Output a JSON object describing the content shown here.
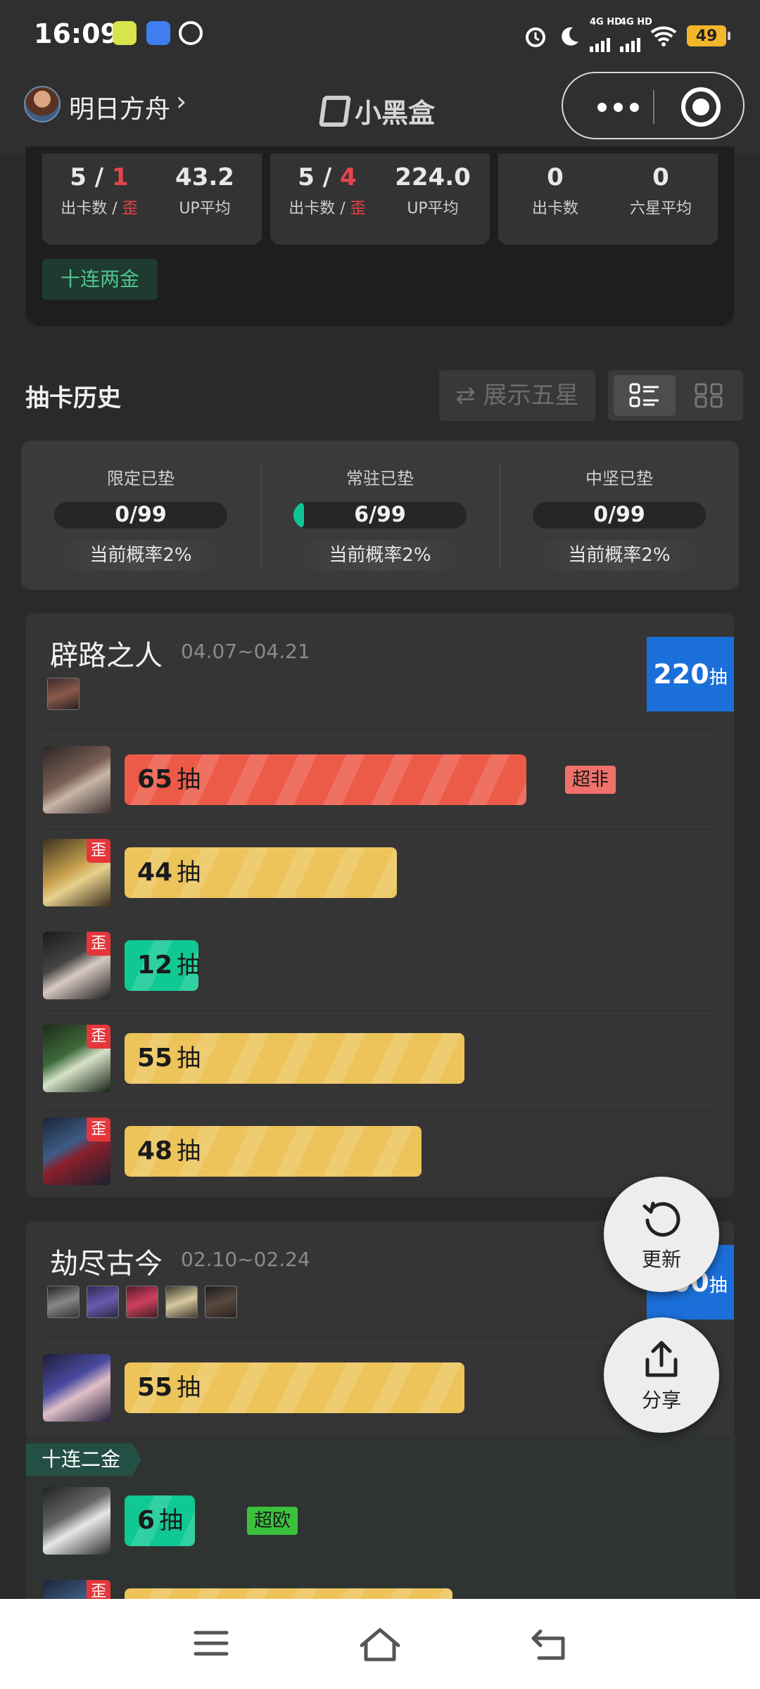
{
  "status_bar": {
    "time": "16:09",
    "network_1": "4G HD",
    "network_2": "4G HD",
    "battery": "49",
    "icons": [
      "app-notification-icon",
      "baidu-paw-icon",
      "circle-speed-icon",
      "alarm-icon",
      "moon-icon",
      "wifi-icon"
    ]
  },
  "nav": {
    "title": "明日方舟",
    "chevron": "›",
    "brand": "小黑盒"
  },
  "summary": {
    "cards": [
      {
        "count": "5",
        "off": "1",
        "avg": "43.2",
        "count_label": "出卡数",
        "off_label": "歪",
        "avg_label": "UP平均"
      },
      {
        "count": "5",
        "off": "4",
        "avg": "224.0",
        "count_label": "出卡数",
        "off_label": "歪",
        "avg_label": "UP平均"
      },
      {
        "count": "0",
        "avg": "0",
        "count_label": "出卡数",
        "avg_label": "六星平均"
      }
    ],
    "slash": "/",
    "tag": "十连两金"
  },
  "history": {
    "title": "抽卡历史",
    "toggle_five_star": "⇄ 展示五星"
  },
  "pity": [
    {
      "label": "限定已垫",
      "value": "0/99",
      "progress": 0,
      "rate": "当前概率2%"
    },
    {
      "label": "常驻已垫",
      "value": "6/99",
      "progress": 0.06,
      "rate": "当前概率2%"
    },
    {
      "label": "中坚已垫",
      "value": "0/99",
      "progress": 0,
      "rate": "当前概率2%"
    }
  ],
  "colors": {
    "bad": "#ec5a48",
    "normal": "#ecc45a",
    "good": "#0fc893",
    "badge_blue": "#1b6fd9"
  },
  "unit": "抽",
  "off_mark": "歪",
  "banners": [
    {
      "title": "辟路之人",
      "date": "04.07~04.21",
      "total": "220",
      "total_unit": "抽",
      "pulls": [
        {
          "count": "65",
          "tier": "bad",
          "off": false,
          "tag": "超非"
        },
        {
          "count": "44",
          "tier": "normal",
          "off": true
        },
        {
          "count": "12",
          "tier": "good",
          "off": true
        },
        {
          "count": "55",
          "tier": "normal",
          "off": true
        },
        {
          "count": "48",
          "tier": "normal",
          "off": true
        }
      ]
    },
    {
      "title": "劫尽古今",
      "date": "02.10~02.24",
      "total": "200",
      "total_unit": "抽",
      "pulls": [
        {
          "count": "55",
          "tier": "normal",
          "off": false
        },
        {
          "count": "6",
          "tier": "good",
          "off": false,
          "tag": "超欧"
        }
      ],
      "multi_label": "十连二金"
    }
  ],
  "fabs": {
    "refresh": "更新",
    "share": "分享"
  }
}
